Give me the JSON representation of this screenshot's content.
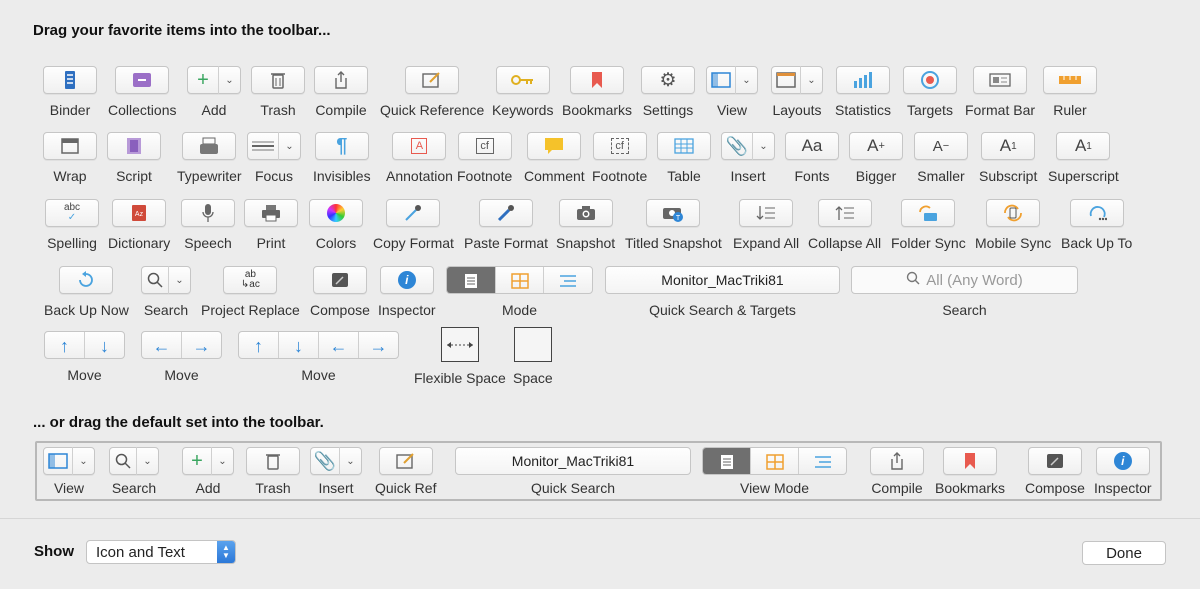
{
  "headings": {
    "top": "Drag your favorite items into the toolbar...",
    "bottom": "... or drag the default set into the toolbar."
  },
  "items": {
    "binder": "Binder",
    "collections": "Collections",
    "add": "Add",
    "trash": "Trash",
    "compile": "Compile",
    "quick_reference": "Quick Reference",
    "keywords": "Keywords",
    "bookmarks": "Bookmarks",
    "settings": "Settings",
    "view": "View",
    "layouts": "Layouts",
    "statistics": "Statistics",
    "targets": "Targets",
    "format_bar": "Format Bar",
    "ruler": "Ruler",
    "wrap": "Wrap",
    "script": "Script",
    "typewriter": "Typewriter",
    "focus": "Focus",
    "invisibles": "Invisibles",
    "annotation": "Annotation",
    "footnote": "Footnote",
    "comment": "Comment",
    "footnote2": "Footnote",
    "table": "Table",
    "insert": "Insert",
    "fonts": "Fonts",
    "bigger": "Bigger",
    "smaller": "Smaller",
    "subscript": "Subscript",
    "superscript": "Superscript",
    "spelling": "Spelling",
    "dictionary": "Dictionary",
    "speech": "Speech",
    "print": "Print",
    "colors": "Colors",
    "copy_format": "Copy Format",
    "paste_format": "Paste Format",
    "snapshot": "Snapshot",
    "titled_snapshot": "Titled Snapshot",
    "expand_all": "Expand All",
    "collapse_all": "Collapse All",
    "folder_sync": "Folder Sync",
    "mobile_sync": "Mobile Sync",
    "back_up_to": "Back Up To",
    "back_up_now": "Back Up Now",
    "search": "Search",
    "project_replace": "Project Replace",
    "compose": "Compose",
    "inspector": "Inspector",
    "mode": "Mode",
    "quick_search_targets": "Quick Search & Targets",
    "search_field": "Search",
    "move1": "Move",
    "move2": "Move",
    "move3": "Move",
    "flexible_space": "Flexible Space",
    "space": "Space"
  },
  "fields": {
    "quick_search_value": "Monitor_MacTriki81",
    "search_placeholder": "All (Any Word)"
  },
  "defaults": {
    "view": "View",
    "search": "Search",
    "add": "Add",
    "trash": "Trash",
    "insert": "Insert",
    "quick_ref": "Quick Ref",
    "quick_search": "Quick Search",
    "quick_search_value": "Monitor_MacTriki81",
    "view_mode": "View Mode",
    "compile": "Compile",
    "bookmarks": "Bookmarks",
    "compose": "Compose",
    "inspector": "Inspector"
  },
  "footer": {
    "show_label": "Show",
    "show_value": "Icon and Text",
    "done": "Done"
  },
  "colors": {
    "blue": "#2e86d6",
    "icon_blue": "#4aa3df",
    "red": "#e85a4f",
    "orange": "#f0a030",
    "purple": "#9b6fc7",
    "gray": "#555555"
  }
}
